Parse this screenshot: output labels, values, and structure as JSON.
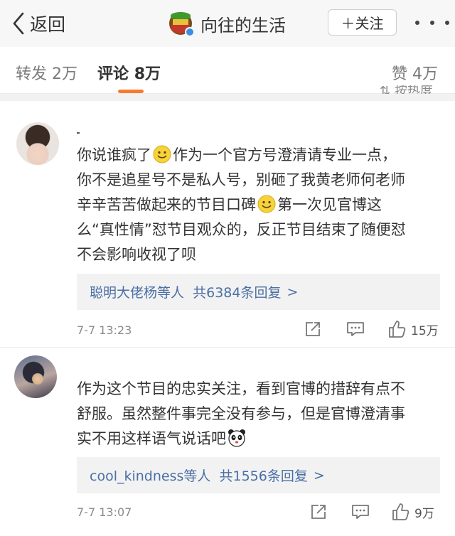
{
  "nav": {
    "back_label": "返回",
    "title": "向往的生活",
    "follow_label": "＋关注"
  },
  "tabs": [
    {
      "label": "转发",
      "count": "2万"
    },
    {
      "label": "评论",
      "count": "8万",
      "active": true
    },
    {
      "label": "赞",
      "count": "4万"
    }
  ],
  "sort_hint": "按热度",
  "comments": [
    {
      "lines": [
        [
          "你说谁疯了",
          "emoji:smile",
          "作为一个官方号澄清请专业一点，"
        ],
        [
          "你不是追星号不是私人号，别砸了我黄老师何老师"
        ],
        [
          "辛辛苦苦做起来的节目口碑",
          "emoji:smile",
          "第一次见官博这"
        ],
        [
          "么“真性情”怼节目观众的，反正节目结束了随便怼"
        ],
        [
          "不会影响收视了呗"
        ]
      ],
      "reply_summary": {
        "users": "聪明大佬杨等人",
        "count_text": "共6384条回复",
        "arrow": ">"
      },
      "time": "7-7 13:23",
      "likes": "15万"
    },
    {
      "lines": [
        [
          "作为这个节目的忠实关注，看到官博的措辞有点不"
        ],
        [
          "舒服。虽然整件事完全没有参与，但是官博澄清事"
        ],
        [
          "实不用这样语气说话吧",
          "emoji:panda"
        ]
      ],
      "reply_summary": {
        "users": "cool_kindness等人",
        "count_text": "共1556条回复",
        "arrow": ">"
      },
      "time": "7-7 13:07",
      "likes": "9万"
    }
  ],
  "icons": [
    "back-chevron-icon",
    "account-logo-icon",
    "verified-badge-icon",
    "more-icon",
    "repost-icon",
    "comment-icon",
    "like-icon",
    "smile-emoji-icon",
    "panda-emoji-icon"
  ],
  "colors": {
    "accent": "#f77c2f",
    "link": "#4a6fa5",
    "nav_bg": "#f7f7f7",
    "reply_bg": "#f2f2f2"
  }
}
